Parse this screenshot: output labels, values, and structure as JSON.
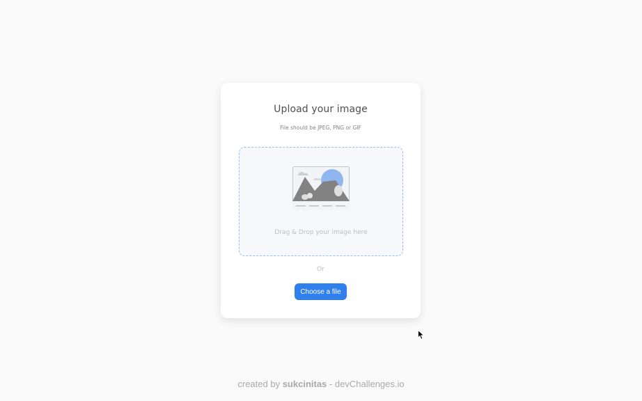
{
  "upload": {
    "title": "Upload your image",
    "subtitle": "File should be JPEG, PNG or GIF",
    "dropzone_text": "Drag & Drop your image here",
    "dropzone_icon": "image-placeholder-icon",
    "or_text": "Or",
    "button_label": "Choose a file"
  },
  "footer": {
    "prefix": "created by",
    "author": "sukcinitas",
    "separator": "-",
    "site": "devChallenges.io"
  },
  "colors": {
    "page_background": "#fafafb",
    "card_background": "#ffffff",
    "accent": "#2f80ed",
    "dropzone_background": "#f6f8fb",
    "dropzone_border": "#97bef4"
  },
  "cursor_icon": "mouse-pointer-icon"
}
